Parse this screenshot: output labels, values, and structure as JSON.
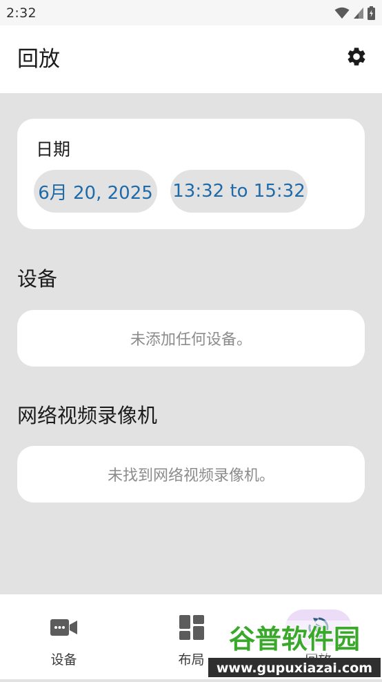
{
  "status_bar": {
    "time": "2:32"
  },
  "app_bar": {
    "title": "回放",
    "settings_icon": "gear-icon"
  },
  "date_card": {
    "label": "日期",
    "date_chip": "6月 20, 2025",
    "time_chip": "13:32 to 15:32"
  },
  "devices": {
    "title": "设备",
    "empty_text": "未添加任何设备。"
  },
  "nvr": {
    "title": "网络视频录像机",
    "empty_text": "未找到网络视频录像机。"
  },
  "bottom_nav": {
    "items": [
      {
        "label": "设备",
        "icon": "video-camera-icon",
        "active": false
      },
      {
        "label": "布局",
        "icon": "layout-grid-icon",
        "active": false
      },
      {
        "label": "回放",
        "icon": "replay-icon",
        "active": true
      }
    ]
  },
  "watermark": {
    "brand": "谷普软件园",
    "url": "www.gupuxiazai.com"
  },
  "colors": {
    "background": "#e2e2e2",
    "chip_text": "#1f6aa8",
    "active_nav": "#ecdcf8",
    "watermark_green": "#3aa82a"
  }
}
